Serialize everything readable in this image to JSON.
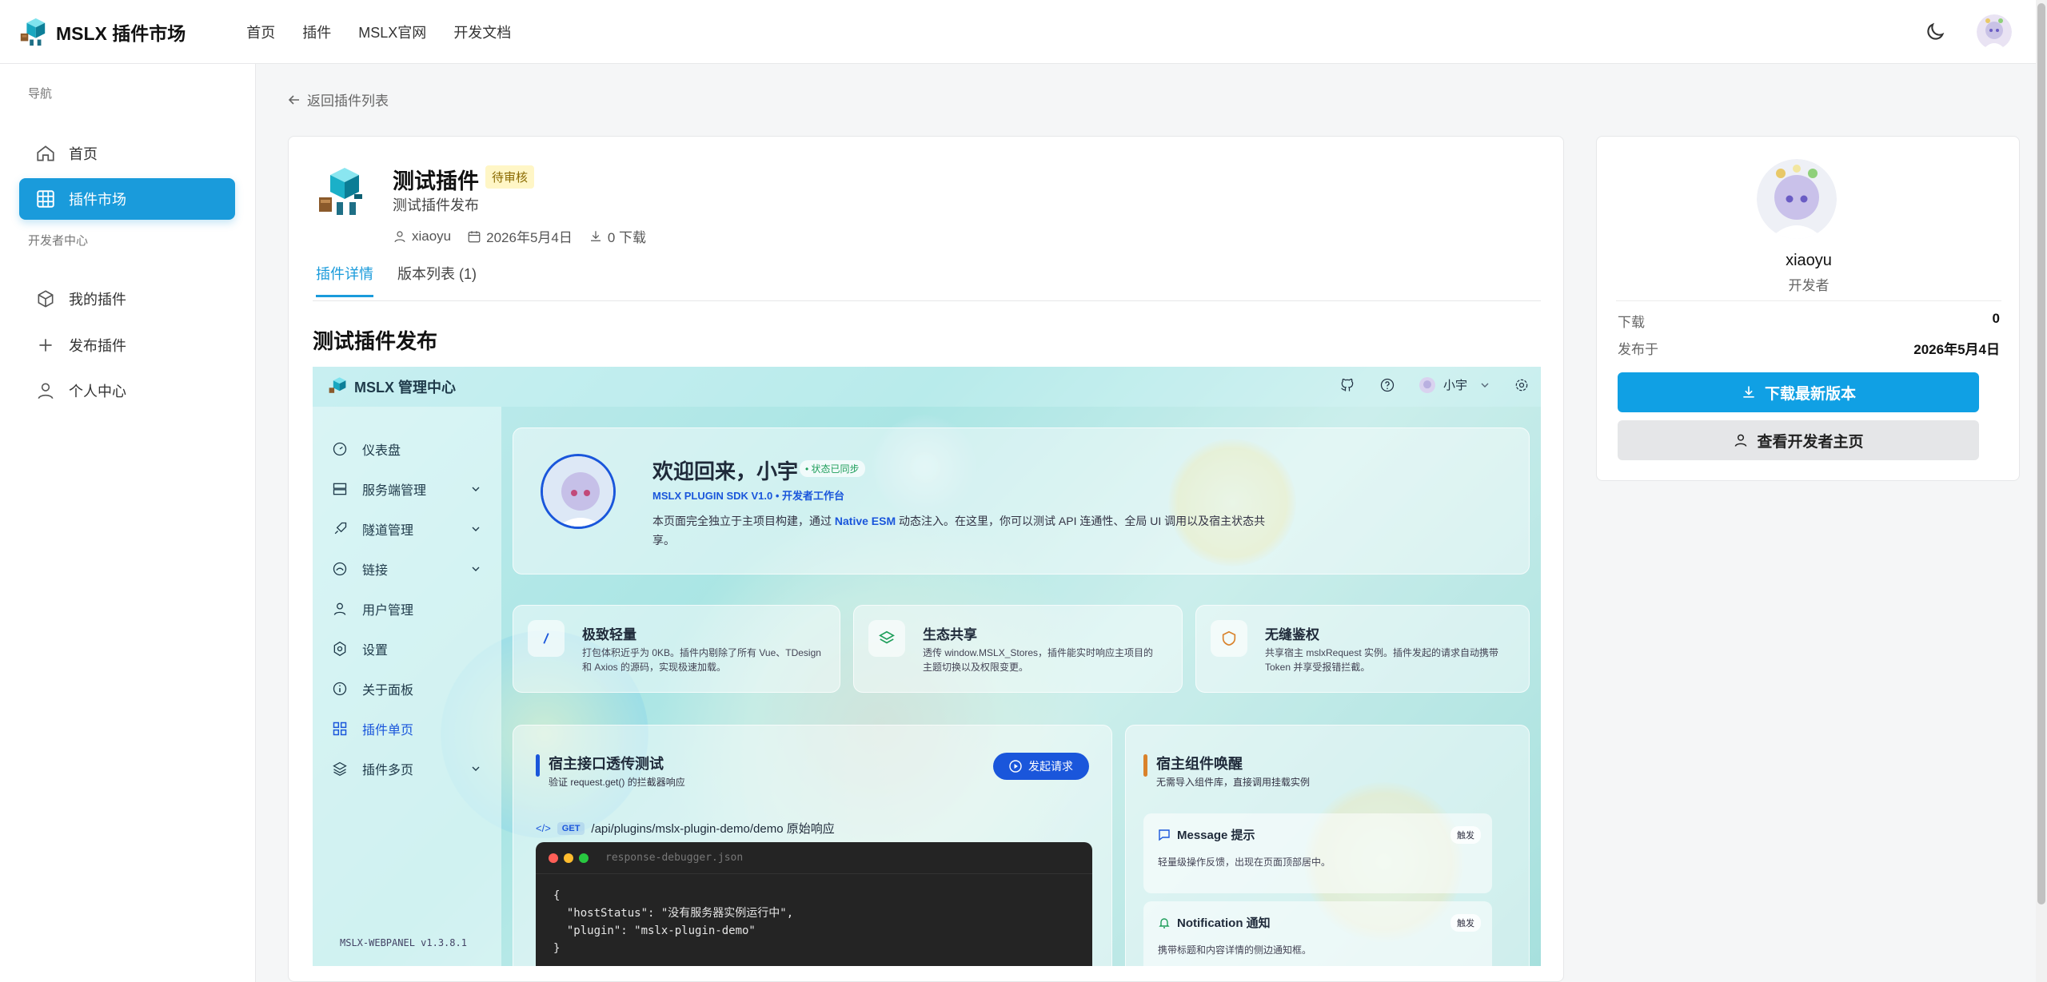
{
  "app": {
    "title": "MSLX 插件市场"
  },
  "nav": {
    "items": [
      "首页",
      "插件",
      "MSLX官网",
      "开发文档"
    ]
  },
  "sidebar": {
    "group_nav": "导航",
    "group_dev": "开发者中心",
    "items": [
      {
        "label": "首页",
        "icon": "home-icon",
        "active": false
      },
      {
        "label": "插件市场",
        "icon": "grid-icon",
        "active": true
      },
      {
        "label": "我的插件",
        "icon": "box-icon",
        "active": false
      },
      {
        "label": "发布插件",
        "icon": "plus-icon",
        "active": false
      },
      {
        "label": "个人中心",
        "icon": "user-icon",
        "active": false
      }
    ]
  },
  "back_link": "返回插件列表",
  "plugin": {
    "name": "测试插件",
    "status": "待审核",
    "description": "测试插件发布",
    "author": "xiaoyu",
    "date": "2026年5月4日",
    "downloads_text": "0 下载"
  },
  "tabs": [
    "插件详情",
    "版本列表 (1)"
  ],
  "doc": {
    "heading": "测试插件发布",
    "screenshot": {
      "brand": "MSLX 管理中心",
      "user": "小宇",
      "menu": [
        {
          "label": "仪表盘",
          "icon": "dashboard-icon",
          "chevron": false
        },
        {
          "label": "服务端管理",
          "icon": "server-icon",
          "chevron": true
        },
        {
          "label": "隧道管理",
          "icon": "rocket-icon",
          "chevron": true
        },
        {
          "label": "链接",
          "icon": "link-icon",
          "chevron": true
        },
        {
          "label": "用户管理",
          "icon": "user-icon",
          "chevron": false
        },
        {
          "label": "设置",
          "icon": "settings-icon",
          "chevron": false
        },
        {
          "label": "关于面板",
          "icon": "info-icon",
          "chevron": false
        },
        {
          "label": "插件单页",
          "icon": "apps-icon",
          "chevron": false,
          "active": true
        },
        {
          "label": "插件多页",
          "icon": "layers-icon",
          "chevron": true
        }
      ],
      "version": "MSLX-WEBPANEL v1.3.8.1",
      "welcome": {
        "title": "欢迎回来，小宇",
        "status": "• 状态已同步",
        "sdk": "MSLX PLUGIN SDK V1.0 • 开发者工作台",
        "desc_pre": "本页面完全独立于主项目构建，通过 ",
        "desc_highlight": "Native ESM",
        "desc_post": " 动态注入。在这里，你可以测试 API 连通性、全局 UI 调用以及宿主状态共享。"
      },
      "features": [
        {
          "title": "极致轻量",
          "desc": "打包体积近乎为 0KB。插件内剔除了所有 Vue、TDesign 和 Axios 的源码，实现极速加载。"
        },
        {
          "title": "生态共享",
          "desc": "透传 window.MSLX_Stores，插件能实时响应主项目的主题切换以及权限变更。"
        },
        {
          "title": "无缝鉴权",
          "desc": "共享宿主 mslxRequest 实例。插件发起的请求自动携带 Token 并享受报错拦截。"
        }
      ],
      "api_test": {
        "title": "宿主接口透传测试",
        "desc": "验证 request.get() 的拦截器响应",
        "button": "发起请求",
        "method": "GET",
        "path": "/api/plugins/mslx-plugin-demo/demo 原始响应",
        "filename": "response-debugger.json",
        "code": "{\n  \"hostStatus\": \"没有服务器实例运行中\",\n  \"plugin\": \"mslx-plugin-demo\"\n}"
      },
      "host_comp": {
        "title": "宿主组件唤醒",
        "desc": "无需导入组件库，直接调用挂载实例",
        "items": [
          {
            "title": "Message 提示",
            "desc": "轻量级操作反馈，出现在页面顶部居中。",
            "button": "触发"
          },
          {
            "title": "Notification 通知",
            "desc": "携带标题和内容详情的侧边通知框。",
            "button": "触发"
          }
        ]
      }
    }
  },
  "developer": {
    "name": "xiaoyu",
    "role": "开发者",
    "stats": [
      {
        "label": "下载",
        "value": "0"
      },
      {
        "label": "发布于",
        "value": "2026年5月4日"
      }
    ],
    "download_button": "下载最新版本",
    "profile_button": "查看开发者主页"
  },
  "colors": {
    "accent": "#1a9bdb",
    "primary_button": "#10a0e4",
    "badge_bg": "#fff6c6"
  }
}
